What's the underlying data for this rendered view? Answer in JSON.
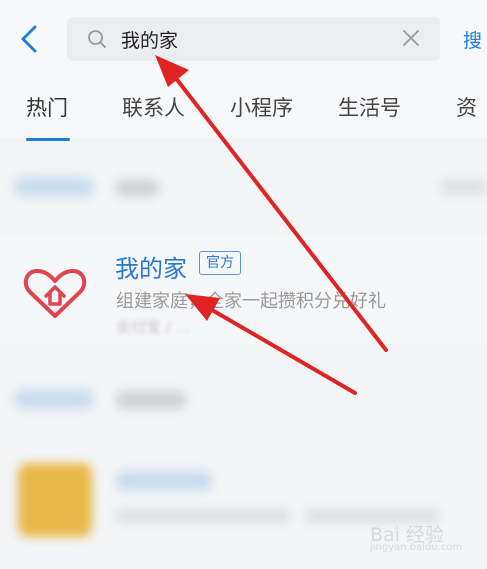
{
  "search": {
    "query": "我的家",
    "button_label": "搜"
  },
  "tabs": [
    {
      "label": "热门",
      "active": true
    },
    {
      "label": "联系人"
    },
    {
      "label": "小程序"
    },
    {
      "label": "生活号"
    },
    {
      "label": "资"
    }
  ],
  "result": {
    "title": "我的家",
    "badge": "官方",
    "description": "组建家庭，全家一起攒积分兑好礼",
    "source": "支付宝 / ..."
  },
  "colors": {
    "accent": "#1b7fe0",
    "arrow": "#e02424",
    "logo": "#e0444e"
  },
  "watermark": {
    "text": "Bai 经验",
    "url": "jingyan.baidu.com"
  }
}
